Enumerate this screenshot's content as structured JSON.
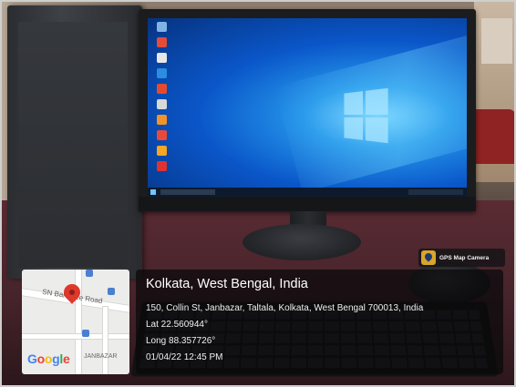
{
  "gps_overlay": {
    "app_badge": "GPS Map Camera",
    "city_line": "Kolkata, West Bengal, India",
    "address": "150, Collin St, Janbazar, Taltala, Kolkata, West Bengal 700013, India",
    "latitude": "Lat 22.560944°",
    "longitude": "Long 88.357726°",
    "datetime": "01/04/22 12:45 PM"
  },
  "map": {
    "street_label": "SN Banerjee Road",
    "area_label": "JANBAZAR",
    "provider_logo": "Google"
  },
  "icons": [
    "map-pin-icon",
    "gps-map-camera-icon",
    "windows-logo-icon"
  ]
}
